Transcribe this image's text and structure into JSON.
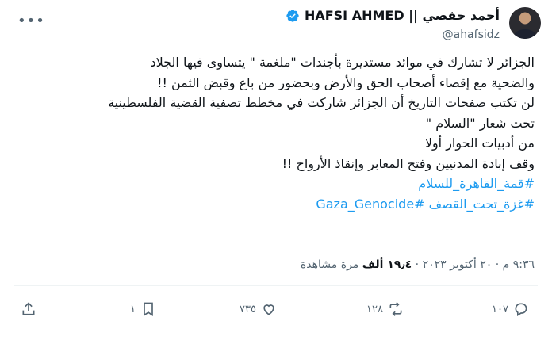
{
  "author": {
    "display_name": "أحمد حفصي || HAFSI AHMED",
    "handle": "@ahafsidz",
    "verified": true
  },
  "tweet": {
    "lines": [
      "الجزائر لا تشارك في موائد مستديرة بأجندات \"ملغمة \" يتساوى فيها الجلاد",
      "والضحية مع إقصاء أصحاب الحق  والأرض وبحضور من باع وقبض الثمن !!",
      "لن تكتب صفحات التاريخ أن الجزائر شاركت في مخطط تصفية القضية الفلسطينية",
      "تحت شعار \"السلام \"",
      "من أدبيات الحوار أولا",
      "وقف إبادة المدنيين وفتح المعابر وإنقاذ الأرواح !!"
    ],
    "hashtags": [
      "#قمة_القاهرة_للسلام",
      "#غزة_تحت_القصف #Gaza_Genocide"
    ]
  },
  "meta": {
    "time": "٩:٣٦ م",
    "separator": "·",
    "date": "٢٠ أكتوبر ٢٠٢٣",
    "views_count": "١٩٫٤ ألف",
    "views_label": "مرة مشاهدة"
  },
  "actions": {
    "replies": "١٠٧",
    "reposts": "١٢٨",
    "likes": "٧٣٥",
    "bookmarks": "١"
  },
  "icons": {
    "more": "more-icon",
    "reply": "reply-icon",
    "repost": "repost-icon",
    "like": "heart-icon",
    "bookmark": "bookmark-icon",
    "share": "share-icon",
    "verified": "verified-badge-icon"
  },
  "colors": {
    "accent": "#1d9bf0",
    "secondary_text": "#536471",
    "primary_text": "#0f1419",
    "divider": "#eff3f4"
  }
}
